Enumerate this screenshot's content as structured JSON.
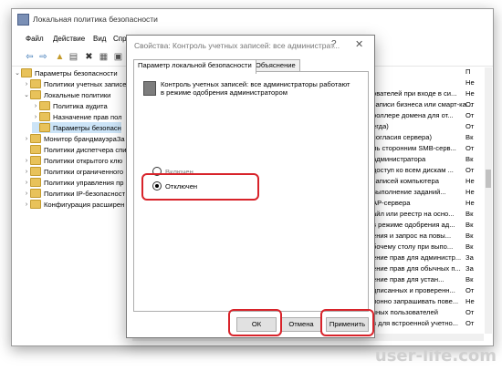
{
  "window": {
    "title": "Локальная политика безопасности"
  },
  "menu": [
    "Файл",
    "Действие",
    "Вид",
    "Спра"
  ],
  "tree": [
    {
      "label": "Параметры безопасности",
      "level": 0,
      "chev": "v"
    },
    {
      "label": "Политики учетных записей",
      "level": 1,
      "chev": ">"
    },
    {
      "label": "Локальные политики",
      "level": 1,
      "chev": "v"
    },
    {
      "label": "Политика аудита",
      "level": 2,
      "chev": ">"
    },
    {
      "label": "Назначение прав пол",
      "level": 2,
      "chev": ">"
    },
    {
      "label": "Параметры безопасн",
      "level": 2,
      "chev": "",
      "selected": true
    },
    {
      "label": "Монитор брандмауэраЗа",
      "level": 1,
      "chev": ">"
    },
    {
      "label": "Политики диспетчера спи",
      "level": 1,
      "chev": ""
    },
    {
      "label": "Политики открытого клю",
      "level": 1,
      "chev": ">"
    },
    {
      "label": "Политики ограниченного",
      "level": 1,
      "chev": ">"
    },
    {
      "label": "Политики управления пр",
      "level": 1,
      "chev": ">"
    },
    {
      "label": "Политики IP-безопасност",
      "level": 1,
      "chev": ">"
    },
    {
      "label": "Конфигурация расширен",
      "level": 1,
      "chev": ">"
    }
  ],
  "list_header": {
    "c1": "",
    "c2": "П"
  },
  "list": [
    {
      "c1": "",
      "c2": "Не"
    },
    {
      "c1": "ователей при входе в си...",
      "c2": "Не"
    },
    {
      "c1": "записи бизнеса или смарт-ка...",
      "c2": "От"
    },
    {
      "c1": "роллере домена для от...",
      "c2": "От"
    },
    {
      "c1": "егда)",
      "c2": "От"
    },
    {
      "c1": "согласия сервера)",
      "c2": "Вк"
    },
    {
      "c1": "ль сторонним SMB-серв...",
      "c2": "От"
    },
    {
      "c1": "администратора",
      "c2": "Вк"
    },
    {
      "c1": "доступ ко всем дискам ...",
      "c2": "От"
    },
    {
      "c1": "записей компьютера",
      "c2": "Не"
    },
    {
      "c1": "выполнение заданий...",
      "c2": "Не"
    },
    {
      "c1": "AP-сервера",
      "c2": "Не"
    },
    {
      "c1": "айл или реестр на осно...",
      "c2": "Вк"
    },
    {
      "c1": "в режиме одобрения ад...",
      "c2": "Вк"
    },
    {
      "c1": "ения и запрос на повы...",
      "c2": "Вк"
    },
    {
      "c1": "бочему столу при выпо...",
      "c2": "Вк"
    },
    {
      "c1": "ение прав для администр...",
      "c2": "За"
    },
    {
      "c1": "ение прав для обычных п...",
      "c2": "За"
    },
    {
      "c1": "ение прав для устан...",
      "c2": "Вк"
    },
    {
      "c1": "дписанных и проверенн...",
      "c2": "От"
    },
    {
      "c1": "ионно запрашивать пове...",
      "c2": "Не"
    },
    {
      "c1": "чных пользователей",
      "c2": "От"
    },
    {
      "c1": "в для встроенной учетно...",
      "c2": "От"
    }
  ],
  "dialog": {
    "title": "Свойства: Контроль учетных записей: все администрат...",
    "help": "?",
    "close": "✕",
    "tabs": [
      "Параметр локальной безопасности",
      "Объяснение"
    ],
    "description": "Контроль учетных записей: все администраторы работают в режиме одобрения администратором",
    "options": [
      {
        "label": "Включен",
        "checked": false
      },
      {
        "label": "Отключен",
        "checked": true
      }
    ],
    "buttons": {
      "ok": "ОК",
      "cancel": "Отмена",
      "apply": "Применить"
    }
  },
  "watermark": "user-life.com",
  "colors": {
    "highlight": "#d8232a",
    "selection": "#cce4f7",
    "folder": "#e8c25a"
  }
}
